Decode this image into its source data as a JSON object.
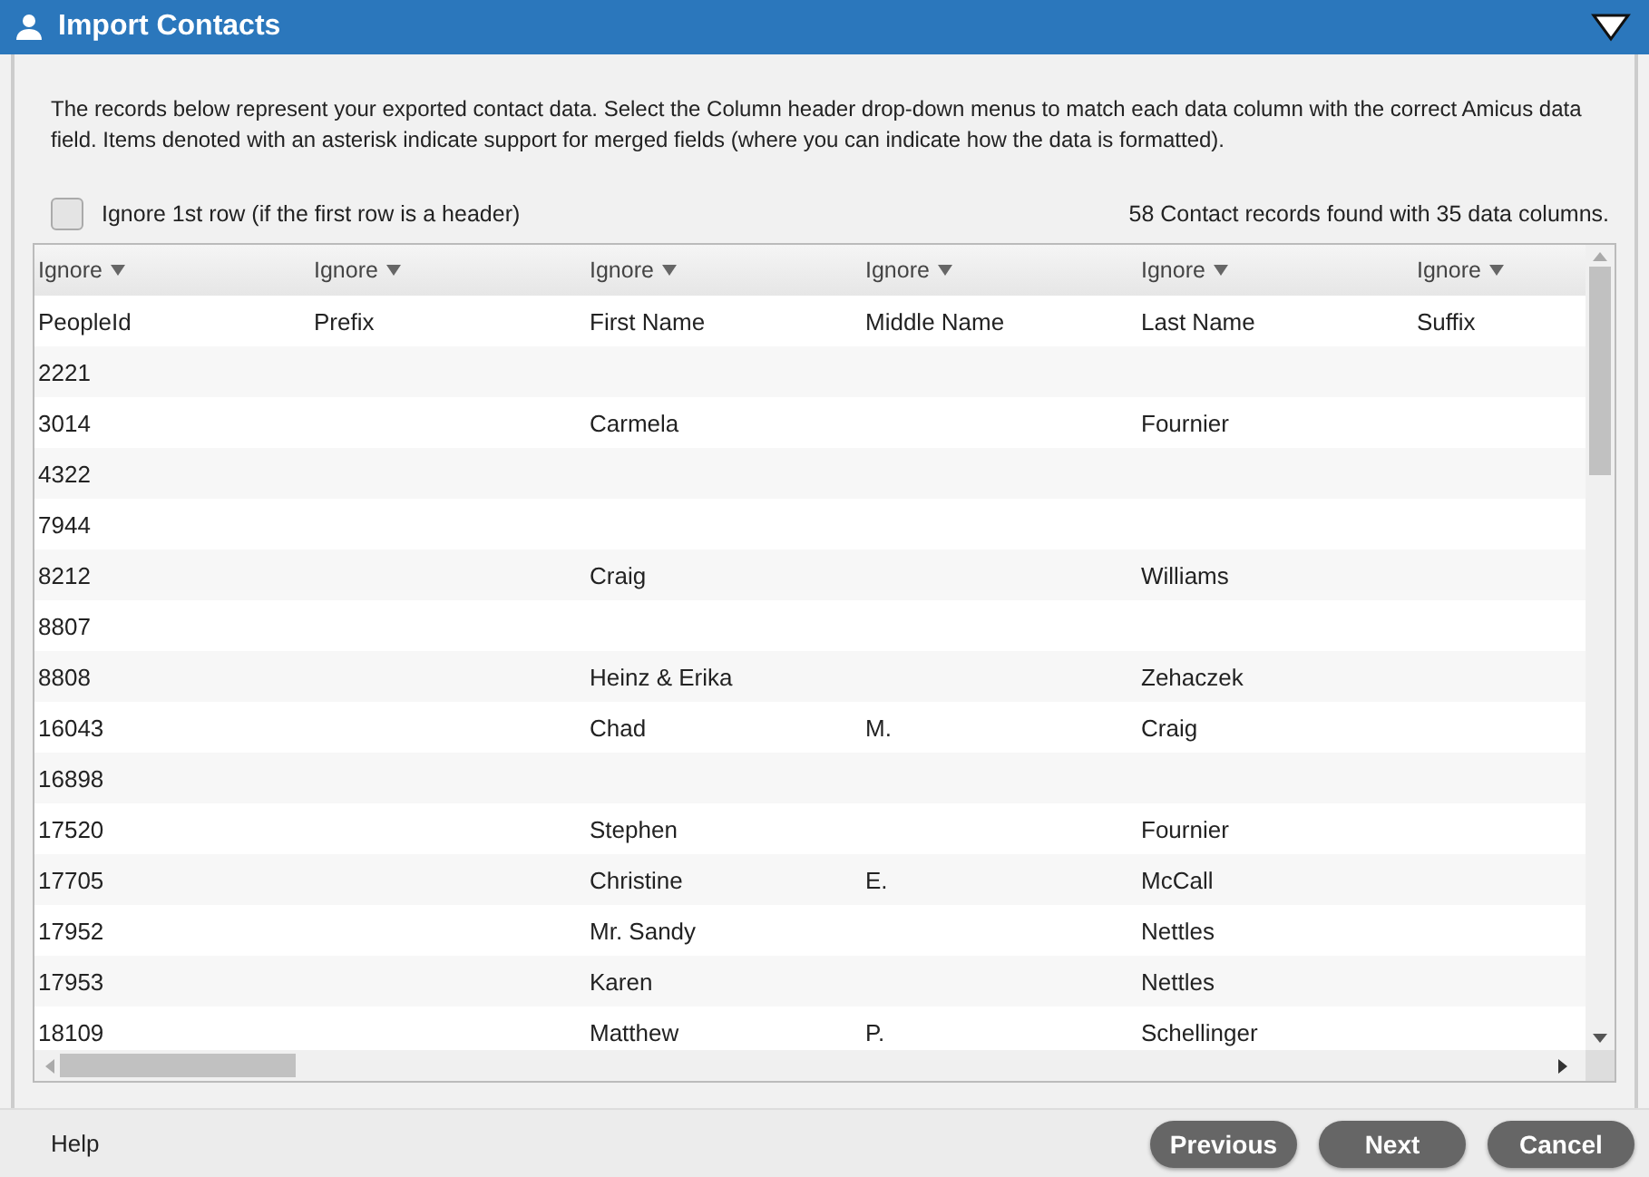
{
  "window": {
    "title": "Import Contacts"
  },
  "intro": "The records below represent your exported contact data. Select the Column header drop-down menus to match each data column with the correct Amicus data field. Items denoted with an asterisk indicate support for merged fields (where you can indicate how the data is formatted).",
  "ignore_first_row": {
    "label": "Ignore 1st row (if the first row is a header)",
    "checked": false
  },
  "summary": "58 Contact records found with 35 data columns.",
  "columns": [
    {
      "mapping": "Ignore",
      "first_row": "PeopleId"
    },
    {
      "mapping": "Ignore",
      "first_row": "Prefix"
    },
    {
      "mapping": "Ignore",
      "first_row": "First Name"
    },
    {
      "mapping": "Ignore",
      "first_row": "Middle Name"
    },
    {
      "mapping": "Ignore",
      "first_row": "Last Name"
    },
    {
      "mapping": "Ignore",
      "first_row": "Suffix"
    }
  ],
  "rows": [
    {
      "c1": "2221"
    },
    {
      "c1": "3014",
      "c3": "Carmela",
      "c5": "Fournier"
    },
    {
      "c1": "4322"
    },
    {
      "c1": "7944"
    },
    {
      "c1": "8212",
      "c3": "Craig",
      "c5": "Williams"
    },
    {
      "c1": "8807"
    },
    {
      "c1": "8808",
      "c3": "Heinz & Erika",
      "c5": "Zehaczek"
    },
    {
      "c1": "16043",
      "c3": "Chad",
      "c4": "M.",
      "c5": "Craig"
    },
    {
      "c1": "16898"
    },
    {
      "c1": "17520",
      "c3": "Stephen",
      "c5": "Fournier"
    },
    {
      "c1": "17705",
      "c3": "Christine",
      "c4": "E.",
      "c5": "McCall"
    },
    {
      "c1": "17952",
      "c3": "Mr. Sandy",
      "c5": "Nettles"
    },
    {
      "c1": "17953",
      "c3": "Karen",
      "c5": "Nettles"
    },
    {
      "c1": "18109",
      "c3": "Matthew",
      "c4": "P.",
      "c5": "Schellinger"
    }
  ],
  "footer": {
    "help": "Help",
    "buttons": [
      "Previous",
      "Next",
      "Cancel"
    ]
  }
}
